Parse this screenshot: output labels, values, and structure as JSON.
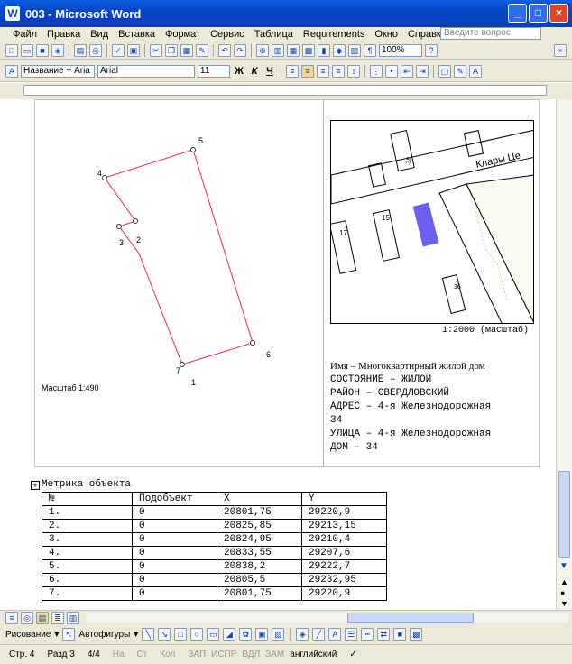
{
  "window": {
    "title": "003 - Microsoft Word",
    "logo": "W"
  },
  "menu": [
    "Файл",
    "Правка",
    "Вид",
    "Вставка",
    "Формат",
    "Сервис",
    "Таблица",
    "Requirements",
    "Окно",
    "Справка"
  ],
  "help_placeholder": "Введите вопрос",
  "toolbar": {
    "zoom": "100%",
    "style": "Название + Aria",
    "font": "Arial",
    "size": "11"
  },
  "format_buttons": [
    "Ж",
    "К",
    "Ч"
  ],
  "plan": {
    "point_labels": [
      "1",
      "2",
      "3",
      "4",
      "5",
      "6",
      "7"
    ],
    "scale": "Масштаб 1:490",
    "line_color": "#e0304a"
  },
  "map": {
    "street": "Клары Це",
    "buildings": [
      "15",
      "17",
      "36",
      "38"
    ],
    "scale": "1:2000 (масштаб)",
    "highlight_color": "#6b5ff0"
  },
  "info": {
    "name": "Имя – Многоквартирный жилой дом",
    "lines": [
      "СОСТОЯНИЕ – ЖИЛОЙ",
      "РАЙОН – СВЕРДЛОВСКИЙ",
      "АДРЕС – 4-я Железнодорожная",
      "34",
      "УЛИЦА – 4-я Железнодорожная",
      "ДОМ – 34"
    ]
  },
  "metric": {
    "title": "Метрика объекта",
    "headers": [
      "№",
      "Подобъект",
      "X",
      "Y"
    ],
    "rows": [
      [
        "1.",
        "0",
        "20801,75",
        "29220,9"
      ],
      [
        "2.",
        "0",
        "20825,85",
        "29213,15"
      ],
      [
        "3.",
        "0",
        "20824,95",
        "29210,4"
      ],
      [
        "4.",
        "0",
        "20833,55",
        "29207,6"
      ],
      [
        "5.",
        "0",
        "20838,2",
        "29222,7"
      ],
      [
        "6.",
        "0",
        "20805,5",
        "29232,95"
      ],
      [
        "7.",
        "0",
        "20801,75",
        "29220,9"
      ]
    ]
  },
  "drawing": {
    "draw_label": "Рисование",
    "autoshapes_label": "Автофигуры"
  },
  "status": {
    "page": "Стр. 4",
    "section": "Разд 3",
    "pages": "4/4",
    "at": "На",
    "line": "Ст",
    "col": "Кол",
    "modes": [
      "ЗАП",
      "ИСПР",
      "ВДЛ",
      "ЗАМ"
    ],
    "language": "английский"
  }
}
